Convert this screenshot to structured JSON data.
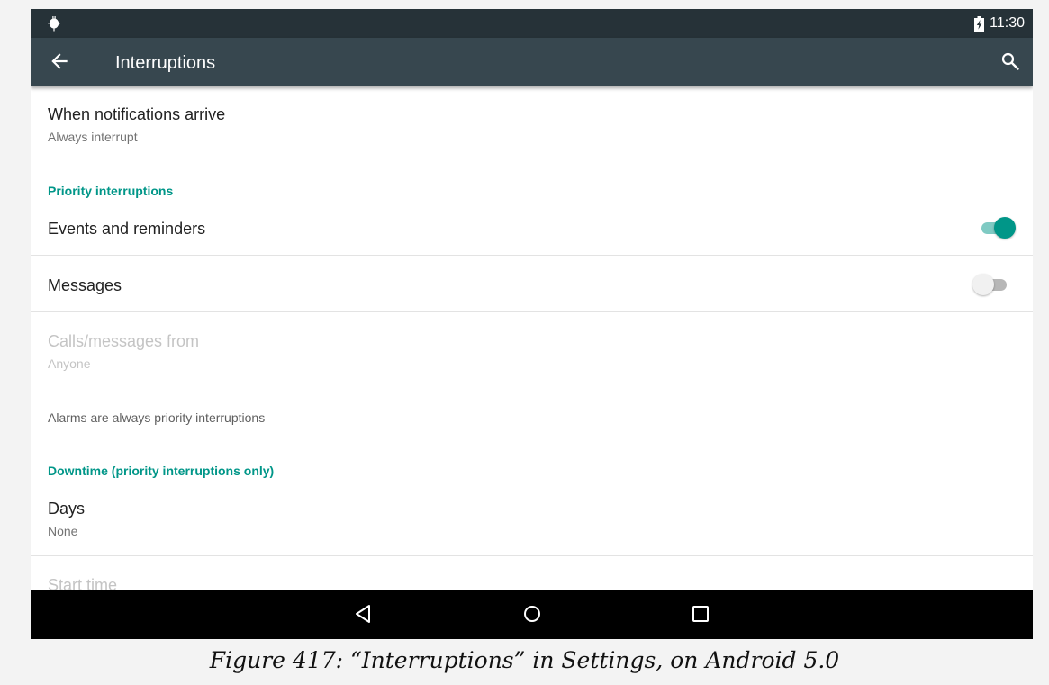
{
  "status_bar": {
    "time": "11:30",
    "left_icon": "android-debug-icon",
    "right_icon": "battery-charging-icon"
  },
  "toolbar": {
    "title": "Interruptions",
    "back_icon": "arrow-back-icon",
    "search_icon": "search-icon"
  },
  "preferences": {
    "when_notifications": {
      "title": "When notifications arrive",
      "summary": "Always interrupt"
    },
    "priority_category": "Priority interruptions",
    "events_reminders": {
      "title": "Events and reminders",
      "checked": true
    },
    "messages": {
      "title": "Messages",
      "checked": false
    },
    "calls_messages_from": {
      "title": "Calls/messages from",
      "summary": "Anyone",
      "enabled": false
    },
    "alarms_note": "Alarms are always priority interruptions",
    "downtime_category": "Downtime (priority interruptions only)",
    "days": {
      "title": "Days",
      "summary": "None"
    },
    "start_time": {
      "title": "Start time",
      "enabled": false
    }
  },
  "nav_bar": {
    "back_icon": "nav-back-triangle-icon",
    "home_icon": "nav-home-circle-icon",
    "recents_icon": "nav-recents-square-icon"
  },
  "caption": "Figure 417: “Interruptions” in Settings, on Android 5.0",
  "colors": {
    "status_bar": "#263238",
    "toolbar": "#37474f",
    "accent": "#009688",
    "accent_track": "#7fcac3",
    "nav_bar": "#000000"
  }
}
